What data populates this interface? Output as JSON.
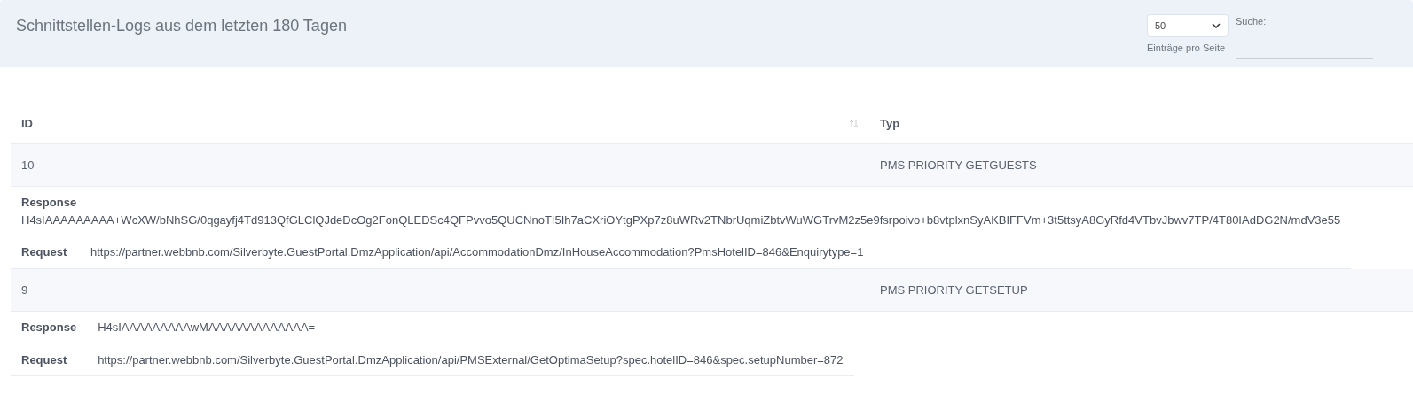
{
  "title": "Schnittstellen-Logs aus dem letzten 180 Tagen",
  "page_length": {
    "value": "50",
    "label": "Einträge pro Seite"
  },
  "search": {
    "label": "Suche:"
  },
  "table": {
    "columns": [
      {
        "label": "ID",
        "sortable": true
      },
      {
        "label": "Typ",
        "sortable": false
      }
    ],
    "rows": [
      {
        "id": "10",
        "type": "PMS PRIORITY GETGUESTS",
        "details": [
          {
            "kind": "stacked",
            "label": "Response",
            "value": "H4sIAAAAAAAAA+WcXW/bNhSG/0qgayfj4Td913QfGLClQJdeDcOg2FonQLEDSc4QFPvvo5QUCNnoTI5Ih7aCXriOYtgPXp7z8uWRv2TNbrUqmiZbtvWuWGTrvM2z5e9fsrpoivo+b8vtplxnSyAKBIFFVm+3t5ttsyA8GyRfd4VTbvJbwv7TP/4T80IAdDG2N/mdV3e55"
          },
          {
            "kind": "inline",
            "label": "Request",
            "value": "https://partner.webbnb.com/Silverbyte.GuestPortal.DmzApplication/api/AccommodationDmz/InHouseAccommodation?PmsHotelID=846&Enquirytype=1"
          }
        ]
      },
      {
        "id": "9",
        "type": "PMS PRIORITY GETSETUP",
        "details": [
          {
            "kind": "inline",
            "label": "Response",
            "value": "H4sIAAAAAAAAAwMAAAAAAAAAAAAA="
          },
          {
            "kind": "inline",
            "label": "Request",
            "value": "https://partner.webbnb.com/Silverbyte.GuestPortal.DmzApplication/api/PMSExternal/GetOptimaSetup?spec.hotelID=846&spec.setupNumber=872"
          }
        ]
      }
    ]
  }
}
